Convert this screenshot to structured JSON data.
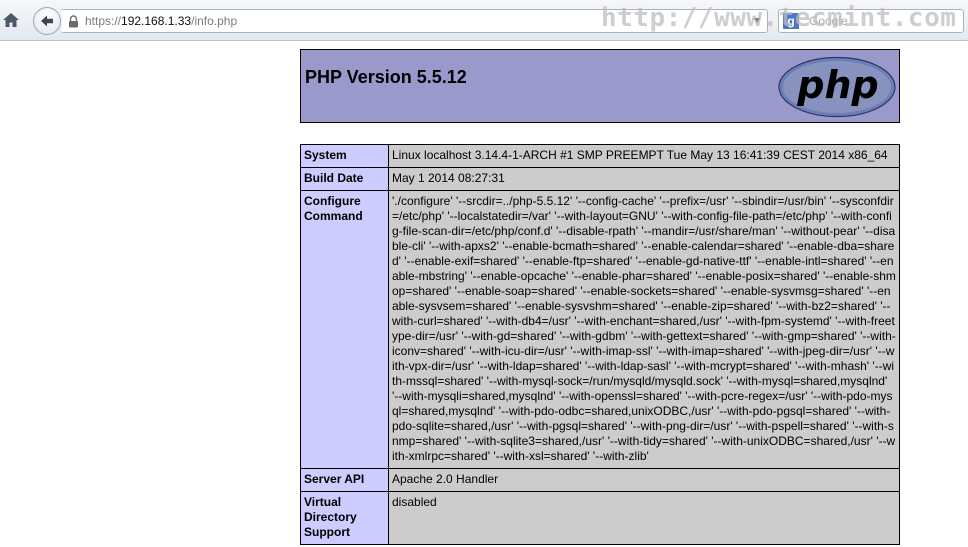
{
  "browser": {
    "url_scheme": "https://",
    "url_host": "192.168.1.33",
    "url_path": "/info.php",
    "search_placeholder": "Google",
    "search_engine_letter": "g",
    "watermark": "http://www.tecmint.com"
  },
  "phpinfo": {
    "title": "PHP Version 5.5.12",
    "logo_text": "php",
    "rows": [
      {
        "label": "System",
        "value": "Linux localhost 3.14.4-1-ARCH #1 SMP PREEMPT Tue May 13 16:41:39 CEST 2014 x86_64"
      },
      {
        "label": "Build Date",
        "value": "May 1 2014 08:27:31"
      },
      {
        "label": "Configure Command",
        "value": "'./configure' '--srcdir=../php-5.5.12' '--config-cache' '--prefix=/usr' '--sbindir=/usr/bin' '--sysconfdir=/etc/php' '--localstatedir=/var' '--with-layout=GNU' '--with-config-file-path=/etc/php' '--with-config-file-scan-dir=/etc/php/conf.d' '--disable-rpath' '--mandir=/usr/share/man' '--without-pear' '--disable-cli' '--with-apxs2' '--enable-bcmath=shared' '--enable-calendar=shared' '--enable-dba=shared' '--enable-exif=shared' '--enable-ftp=shared' '--enable-gd-native-ttf' '--enable-intl=shared' '--enable-mbstring' '--enable-opcache' '--enable-phar=shared' '--enable-posix=shared' '--enable-shmop=shared' '--enable-soap=shared' '--enable-sockets=shared' '--enable-sysvmsg=shared' '--enable-sysvsem=shared' '--enable-sysvshm=shared' '--enable-zip=shared' '--with-bz2=shared' '--with-curl=shared' '--with-db4=/usr' '--with-enchant=shared,/usr' '--with-fpm-systemd' '--with-freetype-dir=/usr' '--with-gd=shared' '--with-gdbm' '--with-gettext=shared' '--with-gmp=shared' '--with-iconv=shared' '--with-icu-dir=/usr' '--with-imap-ssl' '--with-imap=shared' '--with-jpeg-dir=/usr' '--with-vpx-dir=/usr' '--with-ldap=shared' '--with-ldap-sasl' '--with-mcrypt=shared' '--with-mhash' '--with-mssql=shared' '--with-mysql-sock=/run/mysqld/mysqld.sock' '--with-mysql=shared,mysqlnd' '--with-mysqli=shared,mysqlnd' '--with-openssl=shared' '--with-pcre-regex=/usr' '--with-pdo-mysql=shared,mysqlnd' '--with-pdo-odbc=shared,unixODBC,/usr' '--with-pdo-pgsql=shared' '--with-pdo-sqlite=shared,/usr' '--with-pgsql=shared' '--with-png-dir=/usr' '--with-pspell=shared' '--with-snmp=shared' '--with-sqlite3=shared,/usr' '--with-tidy=shared' '--with-unixODBC=shared,/usr' '--with-xmlrpc=shared' '--with-xsl=shared' '--with-zlib'"
      },
      {
        "label": "Server API",
        "value": "Apache 2.0 Handler"
      },
      {
        "label": "Virtual Directory Support",
        "value": "disabled"
      }
    ]
  },
  "colors": {
    "header_bg": "#9999cc",
    "label_bg": "#ccccff",
    "value_bg": "#cccccc"
  }
}
